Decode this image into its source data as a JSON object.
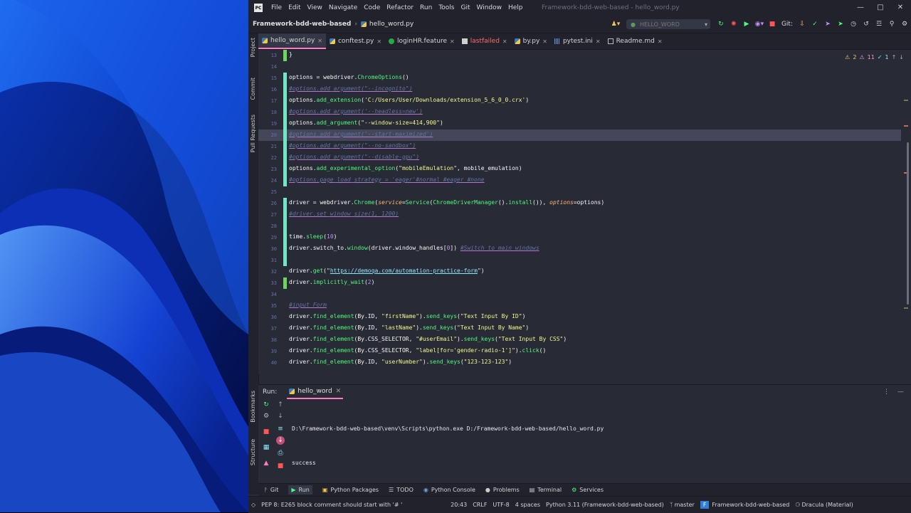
{
  "window": {
    "title": "Framework-bdd-web-based - hello_word.py",
    "app_icon": "PC"
  },
  "menu": [
    "File",
    "Edit",
    "View",
    "Navigate",
    "Code",
    "Refactor",
    "Run",
    "Tools",
    "Git",
    "Window",
    "Help"
  ],
  "breadcrumb": {
    "project": "Framework-bdd-web-based",
    "file": "hello_word.py"
  },
  "toolbar": {
    "run_config": "HELLO_WORD",
    "git_label": "Git:"
  },
  "tabs": [
    {
      "label": "hello_word.py",
      "icon": "python-file-icon",
      "active": true,
      "red": false
    },
    {
      "label": "conftest.py",
      "icon": "python-file-icon",
      "active": false,
      "red": false
    },
    {
      "label": "loginHR.feature",
      "icon": "feature-file-icon",
      "active": false,
      "red": false
    },
    {
      "label": "lastfailed",
      "icon": "text-file-icon",
      "active": false,
      "red": true
    },
    {
      "label": "by.py",
      "icon": "python-file-icon",
      "active": false,
      "red": false
    },
    {
      "label": "pytest.ini",
      "icon": "ini-file-icon",
      "active": false,
      "red": false
    },
    {
      "label": "Readme.md",
      "icon": "markdown-file-icon",
      "active": false,
      "red": false
    }
  ],
  "left_tool_windows": [
    "Project",
    "Commit",
    "Pull Requests"
  ],
  "run_side_tool_windows": [
    "Bookmarks",
    "Structure"
  ],
  "inspections": {
    "warnings": "2",
    "weak_warnings": "11",
    "typos": "1"
  },
  "code_lines": [
    {
      "n": "13",
      "text": "}",
      "change": "added"
    },
    {
      "n": "14",
      "text": "",
      "change": ""
    },
    {
      "n": "15",
      "text": "options = webdriver.ChromeOptions()",
      "change": "modified"
    },
    {
      "n": "16",
      "text": "#options.add_argument(\"--incognito\")",
      "change": "modified"
    },
    {
      "n": "17",
      "text": "options.add_extension('C:/Users/User/Downloads/extension_5_6_0_0.crx')",
      "change": "modified"
    },
    {
      "n": "18",
      "text": "#options.add_argument('--headless=new')",
      "change": "modified"
    },
    {
      "n": "19",
      "text": "options.add_argument(\"--window-size=414,900\")",
      "change": "modified"
    },
    {
      "n": "20",
      "text": "#options.add_argument('--start-maximized')",
      "change": "modified",
      "current": true
    },
    {
      "n": "21",
      "text": "#options.add_argument(\"--no-sandbox\")",
      "change": "modified"
    },
    {
      "n": "22",
      "text": "#options.add_argument(\"--disable-gpu\")",
      "change": "modified"
    },
    {
      "n": "23",
      "text": "options.add_experimental_option(\"mobileEmulation\", mobile_emulation)",
      "change": "modified"
    },
    {
      "n": "24",
      "text": "#options.page_load_strategy = 'eager'#normal #eager #none",
      "change": "modified"
    },
    {
      "n": "25",
      "text": "",
      "change": ""
    },
    {
      "n": "26",
      "text": "driver = webdriver.Chrome(service=Service(ChromeDriverManager().install()), options=options)",
      "change": "modified"
    },
    {
      "n": "27",
      "text": "#driver.set_window_size(1, 1200)",
      "change": "modified"
    },
    {
      "n": "28",
      "text": "",
      "change": "modified"
    },
    {
      "n": "29",
      "text": "time.sleep(10)",
      "change": "modified"
    },
    {
      "n": "30",
      "text": "driver.switch_to.window(driver.window_handles[0]) #Switch to main windows",
      "change": "modified"
    },
    {
      "n": "31",
      "text": "",
      "change": "modified"
    },
    {
      "n": "32",
      "text": "driver.get(\"https://demoqa.com/automation-practice-form\")",
      "change": ""
    },
    {
      "n": "33",
      "text": "driver.implicitly_wait(2)",
      "change": "added"
    },
    {
      "n": "34",
      "text": "",
      "change": ""
    },
    {
      "n": "35",
      "text": "#input Form",
      "change": ""
    },
    {
      "n": "36",
      "text": "driver.find_element(By.ID, \"firstName\").send_keys(\"Text Input By ID\")",
      "change": ""
    },
    {
      "n": "37",
      "text": "driver.find_element(By.ID, \"lastName\").send_keys(\"Text Input By Name\")",
      "change": ""
    },
    {
      "n": "38",
      "text": "driver.find_element(By.CSS_SELECTOR, \"#userEmail\").send_keys(\"Text Input By CSS\")",
      "change": ""
    },
    {
      "n": "39",
      "text": "driver.find_element(By.CSS_SELECTOR, \"label[for='gender-radio-1']\").click()",
      "change": ""
    },
    {
      "n": "40",
      "text": "driver.find_element(By.ID, \"userNumber\").send_keys(\"123-123-123\")",
      "change": ""
    }
  ],
  "run_panel": {
    "label": "Run:",
    "tab": "hello_word",
    "output": [
      "D:\\Framework-bdd-web-based\\venv\\Scripts\\python.exe D:/Framework-bdd-web-based/hello_word.py",
      "success"
    ]
  },
  "bottom_tools": [
    {
      "label": "Git",
      "icon": "git-branch-icon",
      "active": false
    },
    {
      "label": "Run",
      "icon": "run-icon",
      "active": true
    },
    {
      "label": "Python Packages",
      "icon": "packages-icon",
      "active": false
    },
    {
      "label": "TODO",
      "icon": "todo-icon",
      "active": false
    },
    {
      "label": "Python Console",
      "icon": "python-console-icon",
      "active": false
    },
    {
      "label": "Problems",
      "icon": "problems-icon",
      "active": false
    },
    {
      "label": "Terminal",
      "icon": "terminal-icon",
      "active": false
    },
    {
      "label": "Services",
      "icon": "services-icon",
      "active": false
    }
  ],
  "status": {
    "message": "PEP 8: E265 block comment should start with '# '",
    "position": "20:43",
    "line_sep": "CRLF",
    "encoding": "UTF-8",
    "indent": "4 spaces",
    "interpreter": "Python 3.11 (Framework-bdd-web-based)",
    "branch": "master",
    "project": "Framework-bdd-web-based",
    "theme": "Dracula (Material)"
  },
  "colors": {
    "background": "#282a36",
    "accent": "#ff79c6",
    "modified_bar": "#72e6c4",
    "added_bar": "#6cd85a",
    "wallpaper": "#0b2a8a"
  }
}
